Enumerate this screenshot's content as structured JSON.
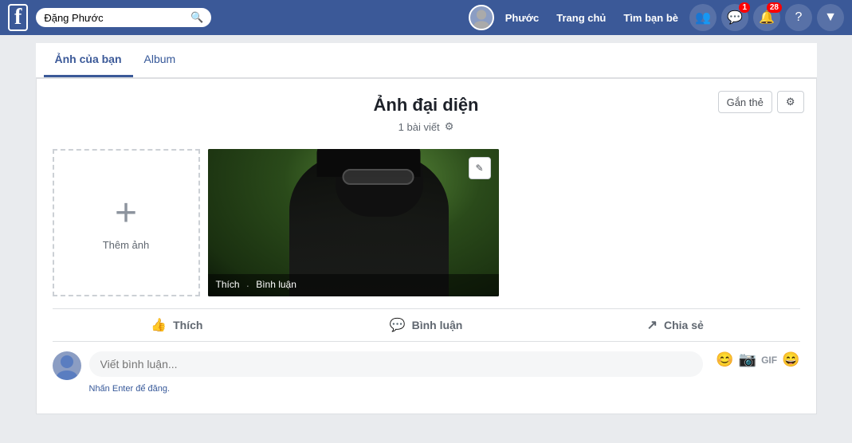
{
  "topnav": {
    "logo": "f",
    "search_placeholder": "Đặng Phước",
    "search_icon": "🔍",
    "user_name": "Phước",
    "nav_links": [
      "Trang chủ",
      "Tìm bạn bè"
    ],
    "icons": {
      "friends": "👥",
      "notifications_badge": "1",
      "messages_badge": "28",
      "help": "?",
      "dropdown": "▼"
    }
  },
  "tabs": [
    {
      "label": "Ảnh của bạn",
      "active": true
    },
    {
      "label": "Album",
      "active": false
    }
  ],
  "album": {
    "title": "Ảnh đại diện",
    "meta": "1 bài viết",
    "gear_label": "⚙"
  },
  "actions_top": {
    "tag_label": "Gắn thẻ",
    "settings_label": "⚙"
  },
  "add_photo": {
    "plus": "+",
    "label": "Thêm ảnh"
  },
  "photo_overlay": {
    "like": "Thích",
    "comment": "Bình luận"
  },
  "edit_btn": "✎",
  "actions_bar": [
    {
      "icon": "👍",
      "label": "Thích"
    },
    {
      "icon": "💬",
      "label": "Bình luận"
    },
    {
      "icon": "↗",
      "label": "Chia sẻ"
    }
  ],
  "comment": {
    "placeholder": "Viết bình luận...",
    "hint": "Nhấn Enter để đăng.",
    "tools": [
      "😊",
      "📷",
      "GIF",
      "😄"
    ]
  }
}
